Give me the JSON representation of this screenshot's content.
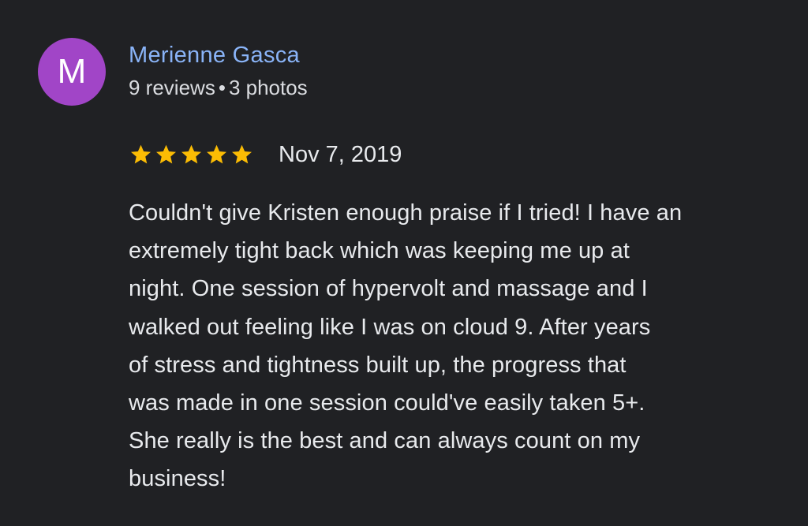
{
  "review": {
    "author": {
      "initial": "M",
      "name": "Merienne Gasca",
      "reviews": "9 reviews",
      "separator": "•",
      "photos": "3 photos",
      "avatar_color": "#a145c7",
      "name_color": "#8ab4f8"
    },
    "rating": {
      "stars": 5,
      "max": 5,
      "icon": "star-icon",
      "color": "#fbbc04"
    },
    "date": "Nov 7, 2019",
    "text_lines": [
      "Couldn't give Kristen enough praise if I tried! I have an",
      "extremely tight back which was keeping me up at",
      "night. One session of hypervolt and massage and I",
      "walked out feeling like I was on cloud 9. After years",
      "of stress and tightness built up, the progress that",
      "was made in one session could've easily taken 5+.",
      "She really is the best and can always count on my",
      "business!"
    ]
  },
  "theme": {
    "background": "#202124",
    "text": "#e8eaed"
  }
}
